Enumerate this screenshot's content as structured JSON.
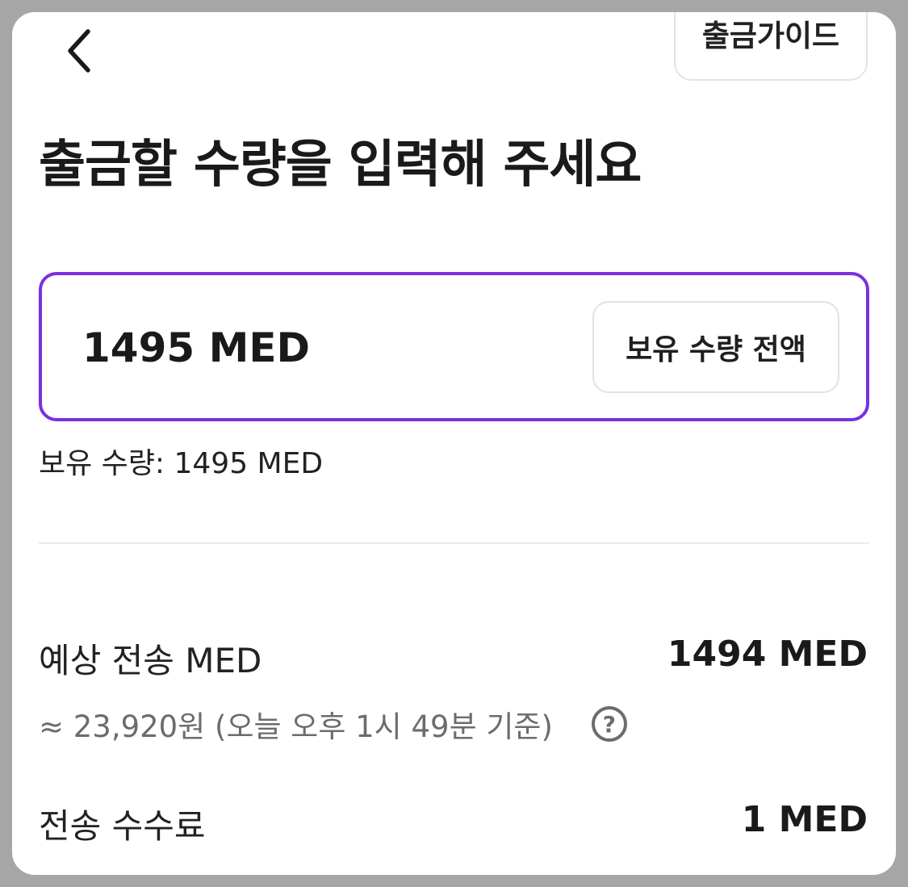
{
  "header": {
    "back_icon": "chevron-left-icon",
    "guide_label": "출금가이드"
  },
  "title": "출금할 수량을 입력해 주세요",
  "amount_input": {
    "value": "1495 MED",
    "max_button_label": "보유 수량 전액"
  },
  "balance": {
    "text": "보유 수량: 1495 MED"
  },
  "summary": {
    "expected_label": "예상 전송 MED",
    "expected_value": "1494 MED",
    "krw_text": "≈ 23,920원 (오늘 오후 1시 49분 기준)",
    "help_icon": "question-circle-icon",
    "help_glyph": "?",
    "fee_label": "전송 수수료",
    "fee_value": "1 MED"
  },
  "colors": {
    "accent": "#7b2fe3",
    "background_overlay": "#a6a6a6",
    "text_primary": "#1a1a1a",
    "text_secondary": "#6c6c6c"
  }
}
